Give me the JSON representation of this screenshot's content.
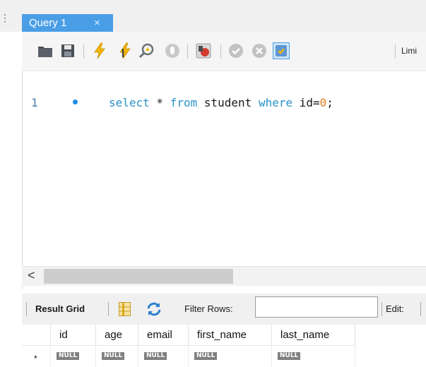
{
  "tab": {
    "title": "Query 1",
    "close_glyph": "×"
  },
  "toolbar": {
    "icons": [
      "open-folder-icon",
      "save-icon",
      "execute-icon",
      "execute-current-icon",
      "explain-icon",
      "stop-icon",
      "toggle-error-icon",
      "commit-icon",
      "rollback-icon",
      "autocommit-icon"
    ],
    "limit_label": "Limi"
  },
  "editor": {
    "line_number": "1",
    "tokens": {
      "t1": "select",
      "t2": " * ",
      "t3": "from",
      "t4": " student ",
      "t5": "where",
      "t6": " id=",
      "t7": "0",
      "t8": ";"
    },
    "colors": {
      "keyword": "#2a92c8",
      "text": "#1a1a1a",
      "number": "#e07a1e",
      "marker": "#1f8de4"
    }
  },
  "hscroll": {
    "left_arrow": "<"
  },
  "result_bar": {
    "result_grid_label": "Result Grid",
    "filter_rows_label": "Filter Rows:",
    "filter_value": "",
    "edit_label": "Edit:"
  },
  "grid": {
    "columns": [
      "id",
      "age",
      "email",
      "first_name",
      "last_name"
    ],
    "null_text": "NULL",
    "new_row_marker": "*"
  },
  "colors": {
    "tab_active": "#4a9ee6"
  }
}
